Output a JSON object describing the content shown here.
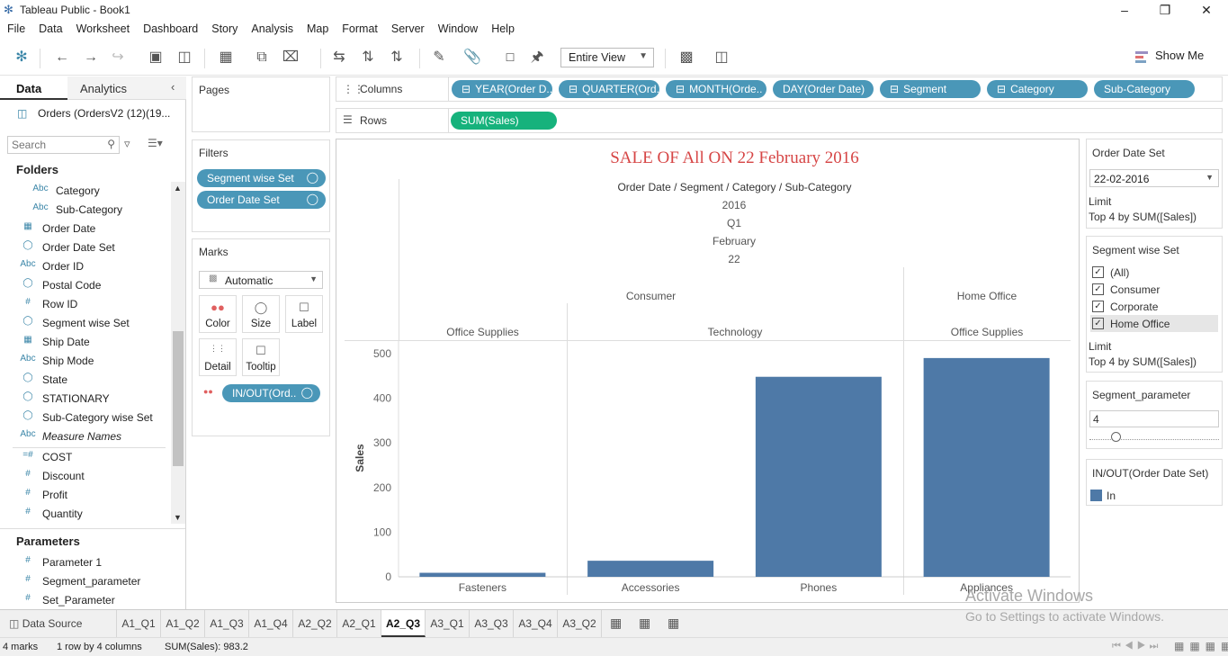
{
  "app": {
    "title": "Tableau Public - Book1"
  },
  "menu": [
    "File",
    "Data",
    "Worksheet",
    "Dashboard",
    "Story",
    "Analysis",
    "Map",
    "Format",
    "Server",
    "Window",
    "Help"
  ],
  "toolbar": {
    "view_mode": "Entire View",
    "show_me": "Show Me"
  },
  "left": {
    "tab_data": "Data",
    "tab_analytics": "Analytics",
    "datasource": "Orders (OrdersV2 (12)(19...",
    "search_placeholder": "Search",
    "folders_heading": "Folders",
    "fields": [
      {
        "type": "Abc",
        "label": "Category",
        "indent": true
      },
      {
        "type": "Abc",
        "label": "Sub-Category",
        "indent": true
      },
      {
        "type": "date",
        "label": "Order Date"
      },
      {
        "type": "set",
        "label": "Order Date Set"
      },
      {
        "type": "Abc",
        "label": "Order ID"
      },
      {
        "type": "geo",
        "label": "Postal Code"
      },
      {
        "type": "#",
        "label": "Row ID"
      },
      {
        "type": "set",
        "label": "Segment wise Set"
      },
      {
        "type": "date",
        "label": "Ship Date"
      },
      {
        "type": "Abc",
        "label": "Ship Mode"
      },
      {
        "type": "geo",
        "label": "State"
      },
      {
        "type": "geo",
        "label": "STATIONARY"
      },
      {
        "type": "set",
        "label": "Sub-Category wise Set"
      },
      {
        "type": "Abc",
        "label": "Measure Names",
        "italic": true
      },
      {
        "type": "calc#",
        "label": "COST"
      },
      {
        "type": "#",
        "label": "Discount"
      },
      {
        "type": "#",
        "label": "Profit"
      },
      {
        "type": "#",
        "label": "Quantity"
      }
    ],
    "parameters_heading": "Parameters",
    "parameters": [
      "Parameter 1",
      "Segment_parameter",
      "Set_Parameter"
    ]
  },
  "pages": {
    "title": "Pages"
  },
  "filters": {
    "title": "Filters",
    "items": [
      "Segment wise Set",
      "Order Date Set"
    ]
  },
  "marks": {
    "title": "Marks",
    "type": "Automatic",
    "buttons": [
      "Color",
      "Size",
      "Label",
      "Detail",
      "Tooltip"
    ],
    "pill": "IN/OUT(Ord.."
  },
  "shelves": {
    "columns_label": "Columns",
    "rows_label": "Rows",
    "columns": [
      "YEAR(Order D..",
      "QUARTER(Ord..",
      "MONTH(Orde..",
      "DAY(Order Date)",
      "Segment",
      "Category",
      "Sub-Category"
    ],
    "rows": [
      "SUM(Sales)"
    ]
  },
  "view": {
    "title": "SALE OF All  ON 22 February 2016",
    "header_path": "Order Date / Segment / Category / Sub-Category",
    "year": "2016",
    "quarter": "Q1",
    "month": "February",
    "day": "22",
    "segments": [
      "Consumer",
      "Home Office"
    ],
    "categories": [
      "Office Supplies",
      "Technology",
      "Office Supplies"
    ]
  },
  "chart_data": {
    "type": "bar",
    "categories": [
      "Fasteners",
      "Accessories",
      "Phones",
      "Appliances"
    ],
    "values": [
      9,
      36,
      448,
      490
    ],
    "ylabel": "Sales",
    "ylim": [
      0,
      520
    ],
    "yticks": [
      "0",
      "100",
      "200",
      "300",
      "400",
      "500"
    ],
    "bar_color": "#4e79a7"
  },
  "right": {
    "order_date_set": {
      "title": "Order Date Set",
      "value": "22-02-2016",
      "limit_label": "Limit",
      "limit_value": "Top 4 by SUM([Sales])"
    },
    "segment_set": {
      "title": "Segment wise Set",
      "items": [
        {
          "label": "(All)",
          "checked": true
        },
        {
          "label": "Consumer",
          "checked": true
        },
        {
          "label": "Corporate",
          "checked": true
        },
        {
          "label": "Home Office",
          "checked": true
        }
      ],
      "limit_label": "Limit",
      "limit_value": "Top 4 by SUM([Sales])"
    },
    "segment_parameter": {
      "title": "Segment_parameter",
      "value": "4"
    },
    "legend": {
      "title": "IN/OUT(Order Date Set)",
      "item": "In"
    }
  },
  "sheets": {
    "datasource": "Data Source",
    "tabs": [
      "A1_Q1",
      "A1_Q2",
      "A1_Q3",
      "A1_Q4",
      "A2_Q2",
      "A2_Q1",
      "A2_Q3",
      "A3_Q1",
      "A3_Q3",
      "A3_Q4",
      "A3_Q2"
    ],
    "active": "A2_Q3"
  },
  "status": {
    "marks": "4 marks",
    "dims": "1 row by 4 columns",
    "sum": "SUM(Sales): 983.2"
  },
  "watermark": {
    "line1": "Activate Windows",
    "line2": "Go to Settings to activate Windows."
  }
}
